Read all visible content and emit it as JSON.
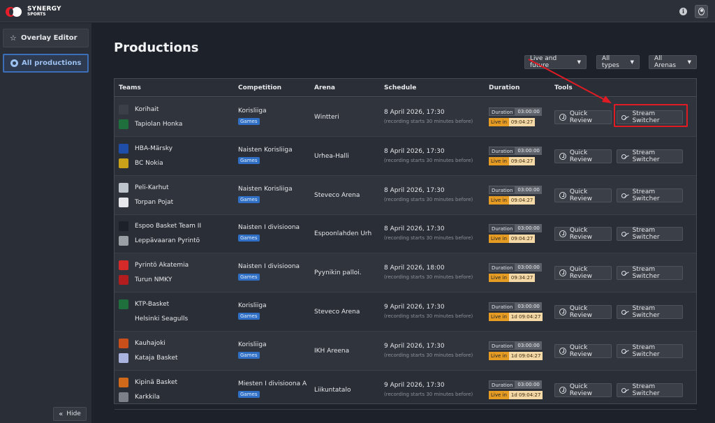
{
  "brand": {
    "line1": "SYNERGY",
    "line2": "SPORTS"
  },
  "topbar": {
    "info_icon": "i"
  },
  "sidebar": {
    "items": [
      {
        "label": "Overlay Editor",
        "icon": "star-icon"
      },
      {
        "label": "All productions",
        "icon": "gear-icon"
      }
    ],
    "hide_label": "Hide",
    "hide_icon": "«"
  },
  "page": {
    "title": "Productions"
  },
  "filters": {
    "time": "Live and future",
    "types": "All types",
    "arenas": "All Arenas",
    "caret": "▼"
  },
  "table": {
    "headers": [
      "Teams",
      "Competition",
      "Arena",
      "Schedule",
      "Duration",
      "Tools"
    ],
    "duration_label": "Duration",
    "live_label": "Live in",
    "quick_review_label": "Quick Review",
    "stream_switcher_label": "Stream Switcher",
    "rows": [
      {
        "team1": "Korihait",
        "team2": "Tapiolan Honka",
        "competition": "Korisliiga",
        "badge": "Games",
        "arena": "Wintteri",
        "schedule": "8 April 2026, 17:30",
        "note": "(recording starts 30 minutes before)",
        "duration": "03:00:00",
        "live_in": "09:04:27"
      },
      {
        "team1": "HBA-Märsky",
        "team2": "BC Nokia",
        "competition": "Naisten Korisliiga",
        "badge": "Games",
        "arena": "Urhea-Halli",
        "schedule": "8 April 2026, 17:30",
        "note": "(recording starts 30 minutes before)",
        "duration": "03:00:00",
        "live_in": "09:04:27"
      },
      {
        "team1": "Peli-Karhut",
        "team2": "Torpan Pojat",
        "competition": "Naisten Korisliiga",
        "badge": "Games",
        "arena": "Steveco Arena",
        "schedule": "8 April 2026, 17:30",
        "note": "(recording starts 30 minutes before)",
        "duration": "03:00:00",
        "live_in": "09:04:27"
      },
      {
        "team1": "Espoo Basket Team II",
        "team2": "Leppävaaran Pyrintö",
        "competition": "Naisten I divisioona",
        "badge": "Games",
        "arena": "Espoonlahden Urh",
        "schedule": "8 April 2026, 17:30",
        "note": "(recording starts 30 minutes before)",
        "duration": "03:00:00",
        "live_in": "09:04:27"
      },
      {
        "team1": "Pyrintö Akatemia",
        "team2": "Turun NMKY",
        "competition": "Naisten I divisioona",
        "badge": "Games",
        "arena": "Pyynikin palloi.",
        "schedule": "8 April 2026, 18:00",
        "note": "(recording starts 30 minutes before)",
        "duration": "03:00:00",
        "live_in": "09:34:27"
      },
      {
        "team1": "KTP-Basket",
        "team2": "Helsinki Seagulls",
        "competition": "Korisliiga",
        "badge": "Games",
        "arena": "Steveco Arena",
        "schedule": "9 April 2026, 17:30",
        "note": "(recording starts 30 minutes before)",
        "duration": "03:00:00",
        "live_in": "1d 09:04:27"
      },
      {
        "team1": "Kauhajoki",
        "team2": "Kataja Basket",
        "competition": "Korisliiga",
        "badge": "Games",
        "arena": "IKH Areena",
        "schedule": "9 April 2026, 17:30",
        "note": "(recording starts 30 minutes before)",
        "duration": "03:00:00",
        "live_in": "1d 09:04:27"
      },
      {
        "team1": "Kipinä Basket",
        "team2": "Karkkila",
        "competition": "Miesten I divisioona A",
        "badge": "Games",
        "arena": "Liikuntatalo",
        "schedule": "9 April 2026, 17:30",
        "note": "(recording starts 30 minutes before)",
        "duration": "03:00:00",
        "live_in": "1d 09:04:27"
      }
    ]
  },
  "colors": {
    "accent": "#2f6fc5",
    "live": "#e69b23",
    "annotation": "#e01b23"
  }
}
